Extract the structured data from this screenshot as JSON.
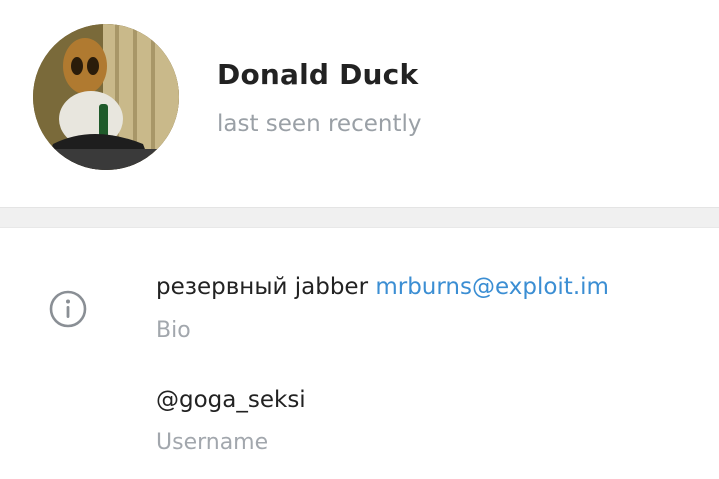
{
  "profile": {
    "name": "Donald Duck",
    "status": "last seen recently"
  },
  "info": {
    "bio_text": "резервный jabber",
    "bio_link": "mrburns@exploit.im",
    "bio_label": "Bio",
    "username": "@goga_seksi",
    "username_label": "Username"
  },
  "icons": {
    "info": "info-circle-icon"
  },
  "colors": {
    "link": "#3b8ed3",
    "muted": "#9aa0a6",
    "text": "#222222",
    "divider": "#f0f0f0"
  }
}
